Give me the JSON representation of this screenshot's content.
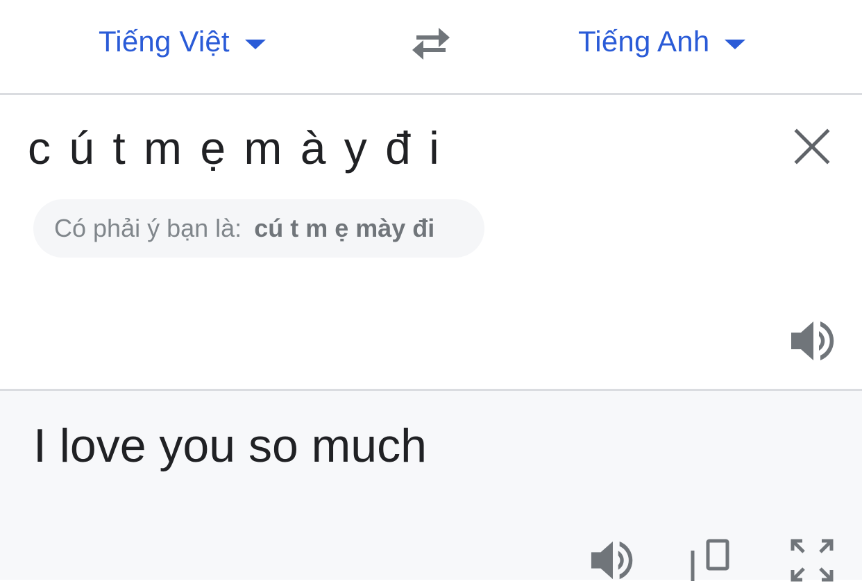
{
  "language_bar": {
    "source_language": "Tiếng Việt",
    "target_language": "Tiếng Anh",
    "swap_icon": "swap-arrows-icon",
    "caret_icon": "caret-down-icon",
    "accent_color": "#2a5bd7"
  },
  "input": {
    "source_text": "c ú t m ẹ m à y đ i",
    "clear_icon": "close-icon",
    "suggestion_prefix": "Có phải ý bạn là:",
    "suggestion_term": "cú t m ẹ mày đi",
    "speak_icon": "speaker-icon"
  },
  "output": {
    "translated_text": "I love you so much",
    "icons": [
      "speaker-icon",
      "copy-icon",
      "fullscreen-icon"
    ]
  }
}
